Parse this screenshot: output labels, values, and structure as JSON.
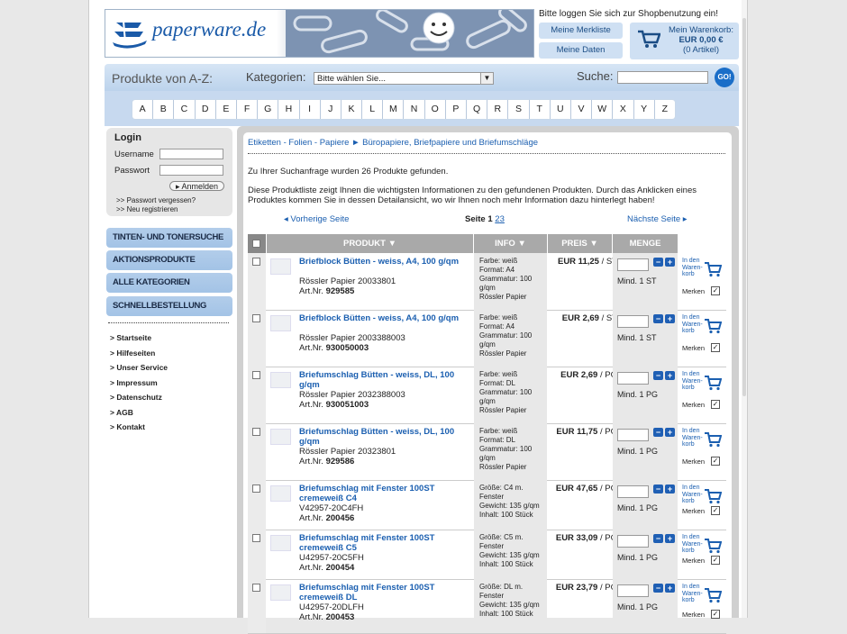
{
  "header": {
    "logo_text": "paperware.de",
    "login_hint": "Bitte loggen Sie sich zur Shopbenutzung ein!",
    "merkliste": "Meine Merkliste",
    "daten": "Meine Daten",
    "cart_line1": "Mein Warenkorb:",
    "cart_line2": "EUR 0,00 €",
    "cart_line3": "(0 Artikel)"
  },
  "catbar": {
    "az_label": "Produkte von A-Z:",
    "kategorien_label": "Kategorien:",
    "select_value": "Bitte wählen Sie...",
    "suche_label": "Suche:",
    "go_label": "GO!"
  },
  "alphabet": [
    "A",
    "B",
    "C",
    "D",
    "E",
    "F",
    "G",
    "H",
    "I",
    "J",
    "K",
    "L",
    "M",
    "N",
    "O",
    "P",
    "Q",
    "R",
    "S",
    "T",
    "U",
    "V",
    "W",
    "X",
    "Y",
    "Z"
  ],
  "login": {
    "title": "Login",
    "username": "Username",
    "passwort": "Passwort",
    "anmelden": "▸ Anmelden",
    "forgot": ">> Passwort vergessen?",
    "register": ">> Neu registrieren"
  },
  "nav": [
    "TINTEN- UND TONERSUCHE",
    "AKTIONSPRODUKTE",
    "ALLE KATEGORIEN",
    "SCHNELLBESTELLUNG"
  ],
  "links": [
    "> Startseite",
    "> Hilfeseiten",
    "> Unser Service",
    "> Impressum",
    "> Datenschutz",
    "> AGB",
    "> Kontakt"
  ],
  "main": {
    "breadcrumb": "Etiketten - Folien - Papiere ► Büropapiere, Briefpapiere und Briefumschläge",
    "found": "Zu Ihrer Suchanfrage wurden 26 Produkte gefunden.",
    "info": "Diese Produktliste zeigt Ihnen die wichtigsten Informationen zu den gefundenen Produkten. Durch das Anklicken eines Produktes kommen Sie in dessen Detailansicht, wo wir Ihnen noch mehr Information dazu hinterlegt haben!",
    "prev": "◂ Vorherige Seite",
    "seite": "Seite",
    "page_current": "1",
    "page2": "2",
    "page3": "3",
    "next": "Nächste Seite ▸",
    "col_produkt": "PRODUKT ▼",
    "col_info": "INFO ▼",
    "col_preis": "PREIS ▼",
    "col_menge": "MENGE",
    "cart_text": "In den Waren- korb",
    "merken": "Merken"
  },
  "products": [
    {
      "name": "Briefblock Bütten - weiss, A4, 100 g/qm",
      "maker": "Rössler Papier 20033801",
      "art": "Art.Nr.",
      "artnr": "929585",
      "info": [
        "Farbe: weiß",
        "Format: A4",
        "Grammatur: 100",
        "g/qm",
        "Rössler Papier"
      ],
      "price": "EUR 11,25",
      "unit": "/ ST",
      "mind": "Mind. 1 ST"
    },
    {
      "name": "Briefblock Bütten - weiss, A4, 100 g/qm",
      "maker": "Rössler Papier 2003388003",
      "art": "Art.Nr.",
      "artnr": "930050003",
      "info": [
        "Farbe: weiß",
        "Format: A4",
        "Grammatur: 100",
        "g/qm",
        "Rössler Papier"
      ],
      "price": "EUR 2,69",
      "unit": "/ ST",
      "mind": "Mind. 1 ST"
    },
    {
      "name": "Briefumschlag Bütten - weiss, DL, 100 g/qm",
      "maker": "Rössler Papier 2032388003",
      "art": "Art.Nr.",
      "artnr": "930051003",
      "info": [
        "Farbe: weiß",
        "Format: DL",
        "Grammatur: 100",
        "g/qm",
        "Rössler Papier"
      ],
      "price": "EUR 2,69",
      "unit": "/ PG",
      "mind": "Mind. 1 PG"
    },
    {
      "name": "Briefumschlag Bütten - weiss, DL, 100 g/qm",
      "maker": "Rössler Papier 20323801",
      "art": "Art.Nr.",
      "artnr": "929586",
      "info": [
        "Farbe: weiß",
        "Format: DL",
        "Grammatur: 100",
        "g/qm",
        "Rössler Papier"
      ],
      "price": "EUR 11,75",
      "unit": "/ PG",
      "mind": "Mind. 1 PG"
    },
    {
      "name": "Briefumschlag mit Fenster 100ST cremeweiß C4",
      "maker": "V42957-20C4FH",
      "art": "Art.Nr.",
      "artnr": "200456",
      "info": [
        "Größe: C4 m.",
        "Fenster",
        "Gewicht: 135 g/qm",
        "Inhalt: 100 Stück"
      ],
      "price": "EUR 47,65",
      "unit": "/ PG",
      "mind": "Mind. 1 PG"
    },
    {
      "name": "Briefumschlag mit Fenster 100ST cremeweiß C5",
      "maker": "U42957-20C5FH",
      "art": "Art.Nr.",
      "artnr": "200454",
      "info": [
        "Größe: C5 m.",
        "Fenster",
        "Gewicht: 135 g/qm",
        "Inhalt: 100 Stück"
      ],
      "price": "EUR 33,09",
      "unit": "/ PG",
      "mind": "Mind. 1 PG"
    },
    {
      "name": "Briefumschlag mit Fenster 100ST cremeweiß DL",
      "maker": "U42957-20DLFH",
      "art": "Art.Nr.",
      "artnr": "200453",
      "info": [
        "Größe: DL m.",
        "Fenster",
        "Gewicht: 135 g/qm",
        "Inhalt: 100 Stück"
      ],
      "price": "EUR 23,79",
      "unit": "/ PG",
      "mind": "Mind. 1 PG"
    }
  ]
}
